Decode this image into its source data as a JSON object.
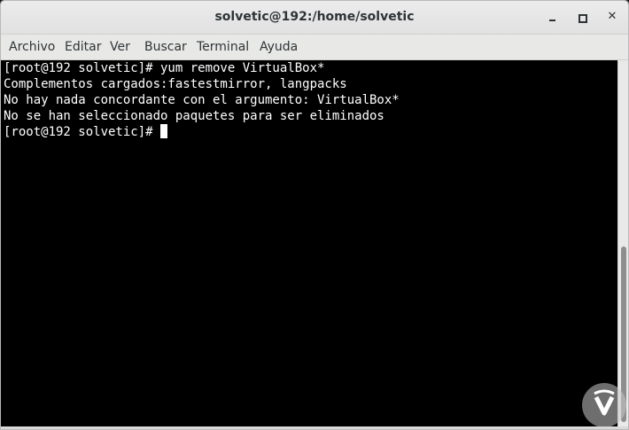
{
  "window": {
    "title": "solvetic@192:/home/solvetic"
  },
  "menu": {
    "items": [
      "Archivo",
      "Editar",
      "Ver",
      "Buscar",
      "Terminal",
      "Ayuda"
    ]
  },
  "terminal": {
    "lines": [
      "[root@192 solvetic]# yum remove VirtualBox*",
      "Complementos cargados:fastestmirror, langpacks",
      "No hay nada concordante con el argumento: VirtualBox*",
      "No se han seleccionado paquetes para ser eliminados"
    ],
    "prompt": "[root@192 solvetic]# "
  },
  "icons": {
    "minimize": "minimize-icon",
    "maximize": "maximize-icon",
    "close": "close-icon",
    "watermark": "solvetic-logo-icon"
  },
  "colors": {
    "terminal_bg": "#000000",
    "terminal_fg": "#ffffff",
    "titlebar_bg": "#e6e6e6"
  }
}
